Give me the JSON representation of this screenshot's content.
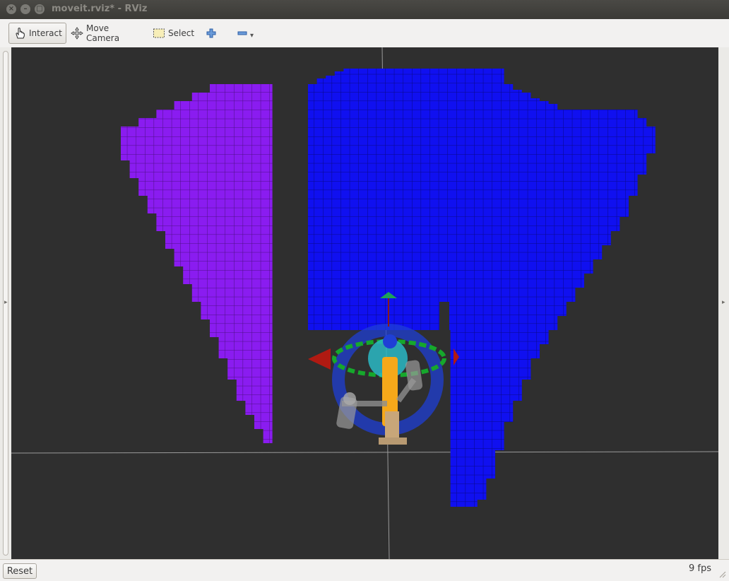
{
  "window": {
    "title": "moveit.rviz* - RViz",
    "controls": {
      "close": "×",
      "minimize": "–",
      "maximize": "□"
    }
  },
  "toolbar": {
    "interact_label": "Interact",
    "move_camera_label": "Move Camera",
    "select_label": "Select",
    "add_tool_icon": "plus-icon",
    "remove_tool_icon": "minus-icon",
    "menu_arrow": "▾"
  },
  "sidebar": {
    "left_arrow": "▸",
    "right_arrow": "▸"
  },
  "statusbar": {
    "reset_label": "Reset",
    "fps_label": "9 fps"
  },
  "colors": {
    "viewport_bg": "#2f2f2f",
    "reachable_purple": "#8a1cf0",
    "reachable_blue": "#1010f0",
    "grid": "#9a9a9a",
    "gizmo_ring_blue": "#1f3fd6",
    "gizmo_ring_green": "#16a82c",
    "gizmo_arrow_red": "#b01a12",
    "gizmo_sphere_cyan": "#2ab8c4",
    "robot_orange": "#f6a81a"
  }
}
